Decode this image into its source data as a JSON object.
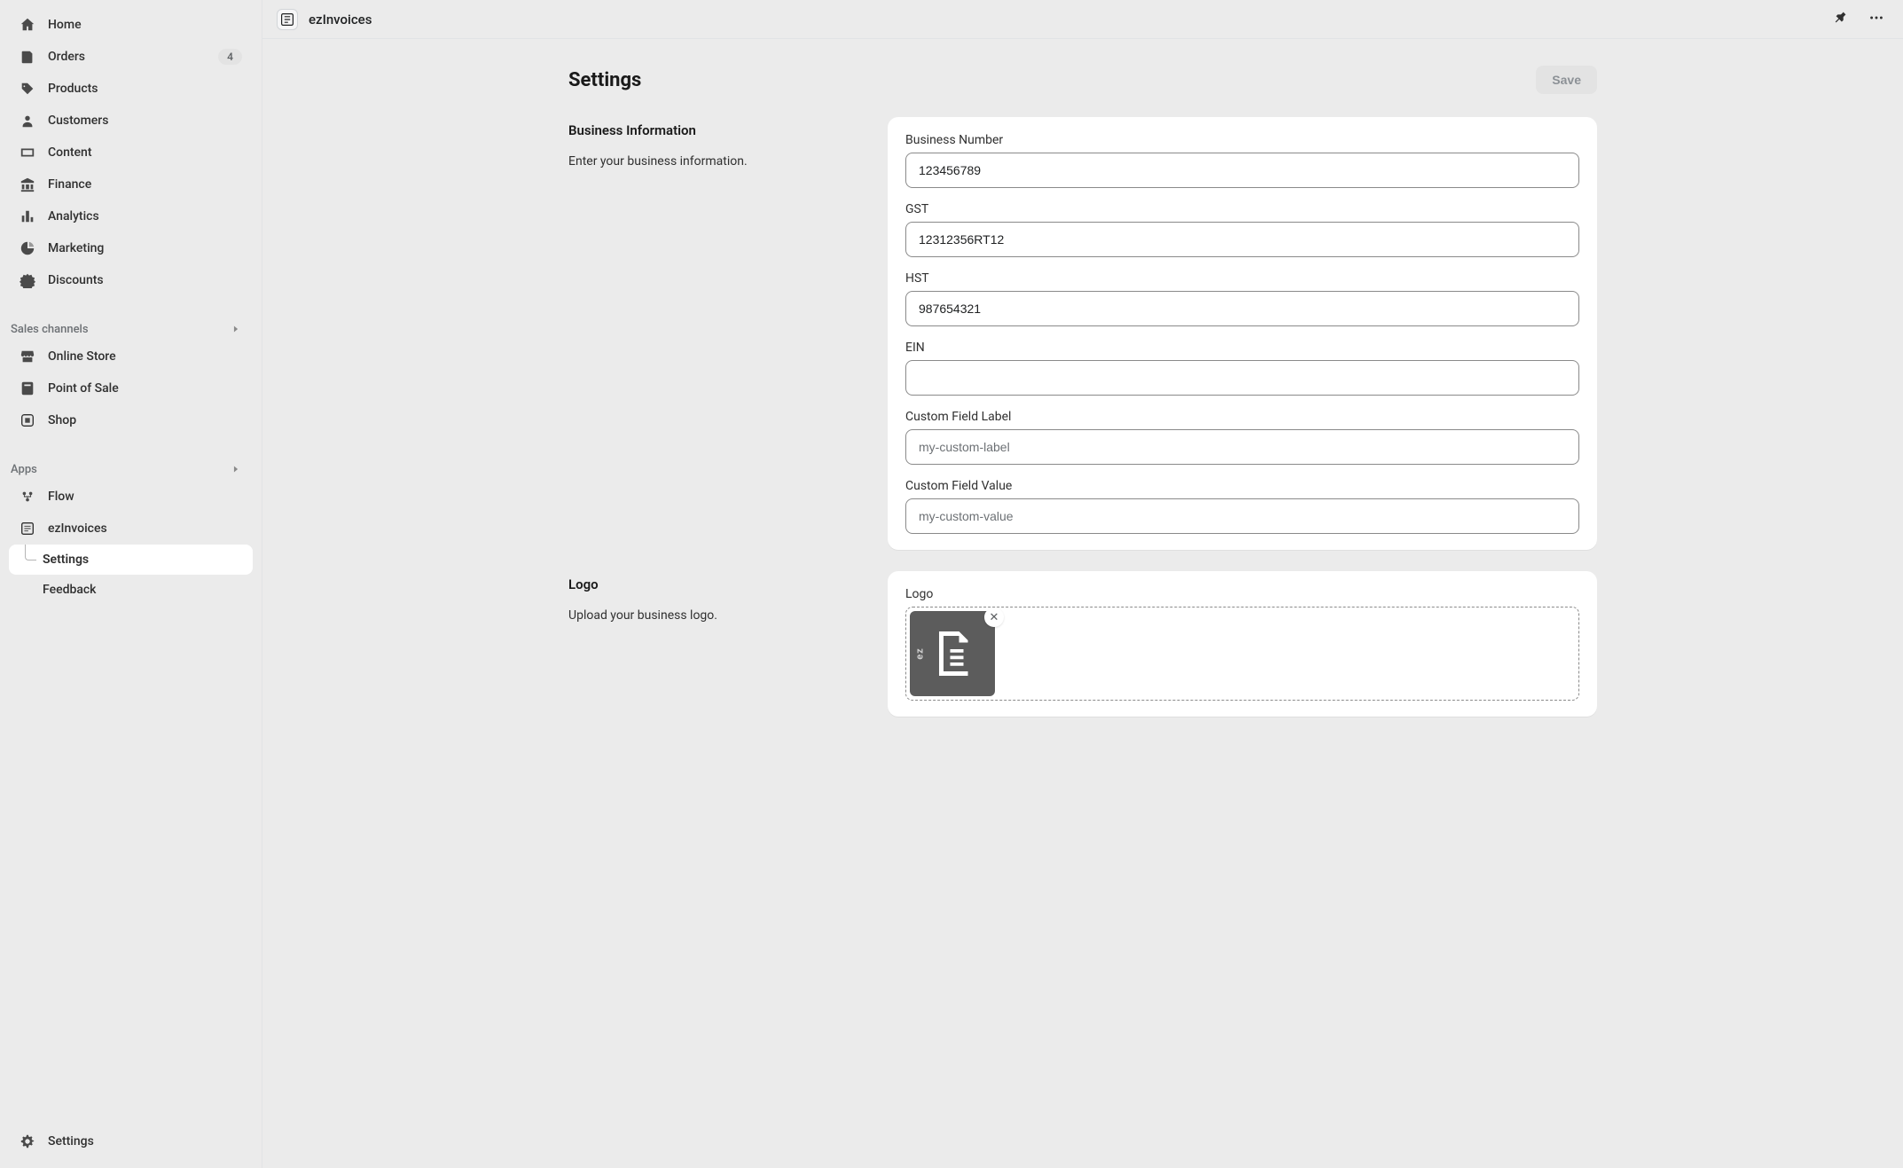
{
  "sidebar": {
    "nav": [
      {
        "icon": "home",
        "label": "Home"
      },
      {
        "icon": "orders",
        "label": "Orders",
        "badge": "4"
      },
      {
        "icon": "products",
        "label": "Products"
      },
      {
        "icon": "customers",
        "label": "Customers"
      },
      {
        "icon": "content",
        "label": "Content"
      },
      {
        "icon": "finance",
        "label": "Finance"
      },
      {
        "icon": "analytics",
        "label": "Analytics"
      },
      {
        "icon": "marketing",
        "label": "Marketing"
      },
      {
        "icon": "discounts",
        "label": "Discounts"
      }
    ],
    "sales_channels_label": "Sales channels",
    "sales_channels": [
      {
        "icon": "store",
        "label": "Online Store"
      },
      {
        "icon": "pos",
        "label": "Point of Sale"
      },
      {
        "icon": "shop",
        "label": "Shop"
      }
    ],
    "apps_label": "Apps",
    "apps": [
      {
        "icon": "flow",
        "label": "Flow"
      },
      {
        "icon": "ezinvoices",
        "label": "ezInvoices"
      }
    ],
    "app_sub": {
      "settings": "Settings",
      "feedback": "Feedback"
    },
    "footer_settings": "Settings"
  },
  "topbar": {
    "title": "ezInvoices"
  },
  "page": {
    "title": "Settings",
    "save": "Save"
  },
  "section_business": {
    "title": "Business Information",
    "desc": "Enter your business information.",
    "fields": {
      "business_number": {
        "label": "Business Number",
        "value": "123456789"
      },
      "gst": {
        "label": "GST",
        "value": "12312356RT12"
      },
      "hst": {
        "label": "HST",
        "value": "987654321"
      },
      "ein": {
        "label": "EIN",
        "value": ""
      },
      "custom_label": {
        "label": "Custom Field Label",
        "placeholder": "my-custom-label",
        "value": ""
      },
      "custom_value": {
        "label": "Custom Field Value",
        "placeholder": "my-custom-value",
        "value": ""
      }
    }
  },
  "section_logo": {
    "title": "Logo",
    "desc": "Upload your business logo.",
    "label": "Logo",
    "thumb_alt": "ez"
  }
}
